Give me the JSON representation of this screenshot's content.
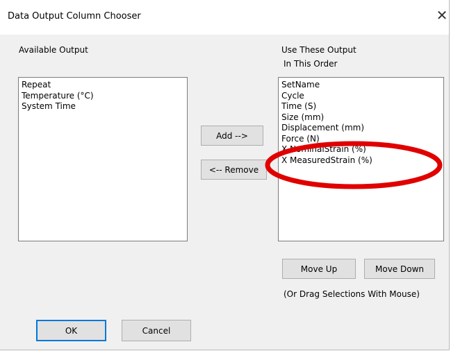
{
  "window": {
    "title": "Data Output Column Chooser",
    "close_glyph": "✕"
  },
  "available": {
    "heading": "Available Output",
    "items": [
      "Repeat",
      "Temperature (°C)",
      "System Time"
    ]
  },
  "selected": {
    "heading_line1": "Use These Output",
    "heading_line2": "In This Order",
    "items": [
      "SetName",
      "Cycle",
      "Time (S)",
      "Size (mm)",
      "Displacement (mm)",
      "Force (N)",
      "X NominalStrain (%)",
      "X MeasuredStrain (%)"
    ]
  },
  "buttons": {
    "add": "Add -->",
    "remove": "<-- Remove",
    "move_up": "Move Up",
    "move_down": "Move Down",
    "ok": "OK",
    "cancel": "Cancel"
  },
  "hint": "(Or Drag Selections With Mouse)",
  "annotation": {
    "color": "#e00000"
  }
}
